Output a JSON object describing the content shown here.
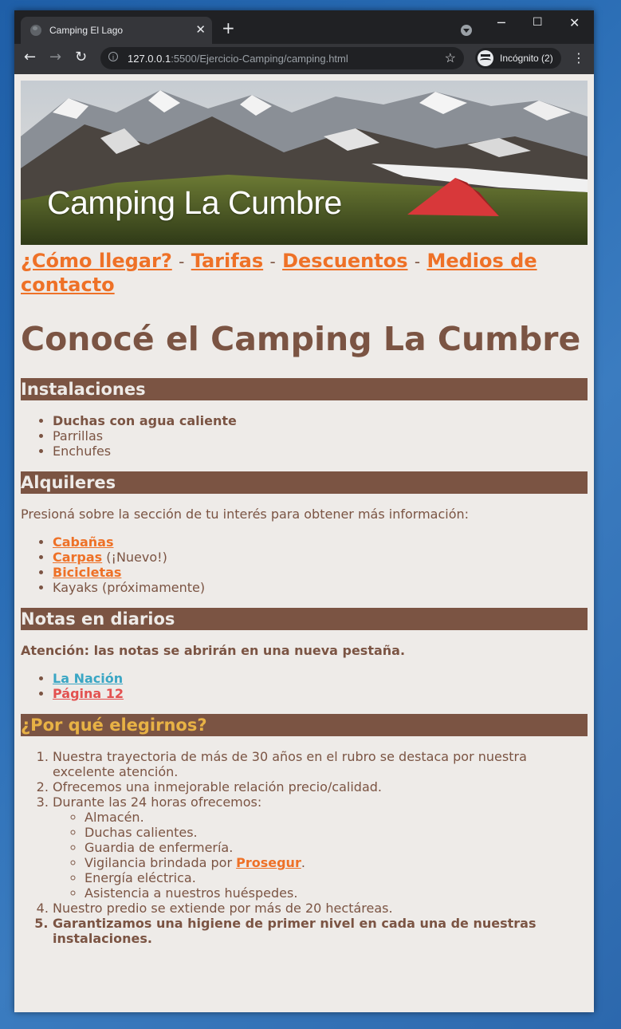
{
  "browser": {
    "tab_title": "Camping El Lago",
    "url_host": "127.0.0.1",
    "url_rest": ":5500/Ejercicio-Camping/camping.html",
    "profile_label": "Incógnito (2)"
  },
  "banner": {
    "title": "Camping La Cumbre"
  },
  "nav": {
    "items": [
      "¿Cómo llegar?",
      "Tarifas",
      "Descuentos",
      "Medios de contacto"
    ],
    "separator": "-"
  },
  "heading": "Conocé el Camping La Cumbre",
  "instalaciones": {
    "title": "Instalaciones",
    "items": [
      "Duchas con agua caliente",
      "Parrillas",
      "Enchufes"
    ]
  },
  "alquileres": {
    "title": "Alquileres",
    "intro": "Presioná sobre la sección de tu interés para obtener más información:",
    "items": [
      {
        "link": "Cabañas",
        "note": ""
      },
      {
        "link": "Carpas",
        "note": " (¡Nuevo!)"
      },
      {
        "link": "Bicicletas",
        "note": ""
      },
      {
        "text": "Kayaks (próximamente)"
      }
    ]
  },
  "notas": {
    "title": "Notas en diarios",
    "warning": "Atención: las notas se abrirán en una nueva pestaña.",
    "links": [
      "La Nación",
      "Página 12"
    ]
  },
  "porque": {
    "title": "¿Por qué elegirnos?",
    "items": [
      "Nuestra trayectoria de más de 30 años en el rubro se destaca por nuestra excelente atención.",
      "Ofrecemos una inmejorable relación precio/calidad.",
      "Durante las 24 horas ofrecemos:",
      "Nuestro predio se extiende por más de 20 hectáreas.",
      "Garantizamos una higiene de primer nivel en cada una de nuestras instalaciones."
    ],
    "sub_items": [
      "Almacén.",
      "Duchas calientes.",
      "Guardia de enfermería.",
      "Vigilancia brindada por ",
      "Energía eléctrica.",
      "Asistencia a nuestros huéspedes."
    ],
    "vigilancia_link": "Prosegur",
    "vigilancia_end": "."
  },
  "colors": {
    "brown": "#7b5443",
    "orange": "#ee7127",
    "gold": "#e8b245",
    "background": "#eeebe8",
    "link_blue": "#3aa6c4",
    "link_red": "#e35150"
  }
}
